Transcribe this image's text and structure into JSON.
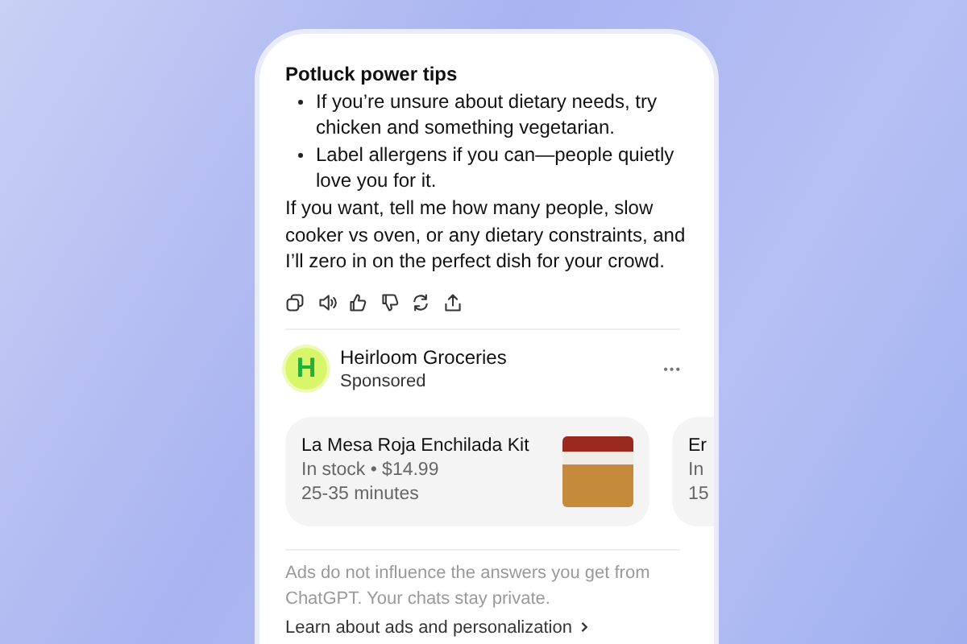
{
  "answer": {
    "heading": "Potluck power tips",
    "bullets": [
      "If you’re unsure about dietary needs, try chicken and something vegetarian.",
      "Label allergens if you can—people quietly love you for it."
    ],
    "closing": "If you want, tell me how many people, slow cooker vs oven, or any dietary constraints, and I’ll zero in on the perfect dish for your crowd."
  },
  "actions": [
    {
      "kind": "copy"
    },
    {
      "kind": "speaker"
    },
    {
      "kind": "thumbs-up"
    },
    {
      "kind": "thumbs-down"
    },
    {
      "kind": "refresh"
    },
    {
      "kind": "share"
    }
  ],
  "sponsor": {
    "logo_letter": "H",
    "name": "Heirloom Groceries",
    "label": "Sponsored",
    "more": "•••"
  },
  "products": [
    {
      "name": "La Mesa Roja Enchilada Kit",
      "detail": "In stock • $14.99",
      "time": "25-35 minutes"
    },
    {
      "name": "Er",
      "detail": "In",
      "time": "15"
    }
  ],
  "disclaimer": {
    "text": "Ads do not influence the answers you get from ChatGPT. Your chats stay private.",
    "link": "Learn about ads and personalization"
  }
}
